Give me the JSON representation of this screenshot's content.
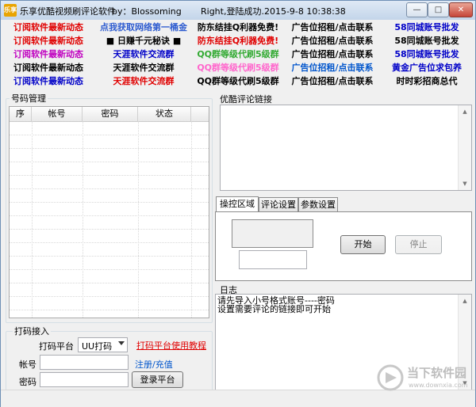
{
  "window": {
    "title": "乐享优酷视频刷评论软件",
    "by": "by：Blossoming",
    "status": "Right,登陆成功.2015-9-8 10:38:38",
    "app_icon_text": "乐享",
    "min_glyph": "—",
    "max_glyph": "□",
    "close_glyph": "✕"
  },
  "links": {
    "rows": [
      [
        {
          "text": "订阅软件最新动态",
          "color": "#e00000"
        },
        {
          "text": "点我获取网络第一桶金",
          "color": "#2f5dd0"
        },
        {
          "text": "防东结挂Q利器免费!",
          "color": "#000000"
        },
        {
          "text": "广告位招租/点击联系",
          "color": "#000000"
        },
        {
          "text": "58同城账号批发",
          "color": "#0000c8"
        }
      ],
      [
        {
          "text": "订阅软件最新动态",
          "color": "#e00000"
        },
        {
          "text": "■ 日赚千元秘诀 ■",
          "color": "#000000"
        },
        {
          "text": "防东结挂Q利器免费!",
          "color": "#e00000"
        },
        {
          "text": "广告位招租/点击联系",
          "color": "#000000"
        },
        {
          "text": "58同城账号批发",
          "color": "#000000"
        }
      ],
      [
        {
          "text": "订阅软件最新动态",
          "color": "#c000c0"
        },
        {
          "text": "天涯软件交流群",
          "color": "#0000c8"
        },
        {
          "text": "QQ群等级代刷5级群",
          "color": "#33aa33"
        },
        {
          "text": "广告位招租/点击联系",
          "color": "#000000"
        },
        {
          "text": "58同城账号批发",
          "color": "#0000c8"
        }
      ],
      [
        {
          "text": "订阅软件最新动态",
          "color": "#000000"
        },
        {
          "text": "天涯软件交流群",
          "color": "#000000"
        },
        {
          "text": "QQ群等级代刷5级群",
          "color": "#ff66cc"
        },
        {
          "text": "广告位招租/点击联系",
          "color": "#0055cc"
        },
        {
          "text": "黄金广告位求包养",
          "color": "#0000c8"
        }
      ],
      [
        {
          "text": "订阅软件最新动态",
          "color": "#0000c8"
        },
        {
          "text": "天涯软件交流群",
          "color": "#e00000"
        },
        {
          "text": "QQ群等级代刷5级群",
          "color": "#000000"
        },
        {
          "text": "广告位招租/点击联系",
          "color": "#000000"
        },
        {
          "text": "时时彩招商总代",
          "color": "#000000"
        }
      ]
    ]
  },
  "accounts": {
    "group_title": "号码管理",
    "columns": [
      "序",
      "帐号",
      "密码",
      "状态"
    ]
  },
  "links_panel": {
    "title": "优酷评论链接"
  },
  "tabs": {
    "items": [
      "操控区域",
      "评论设置",
      "参数设置"
    ],
    "active": 0
  },
  "control": {
    "start_label": "开始",
    "stop_label": "停止"
  },
  "log": {
    "title": "日志",
    "line1": "请先导入小号格式账号----密码",
    "line2": "设置需要评论的链接即可开始"
  },
  "captcha": {
    "group_title": "打码接入",
    "platform_label": "打码平台",
    "platform_value": "UU打码",
    "tutorial_link": "打码平台使用教程",
    "account_label": "帐号",
    "register_link": "注册/充值",
    "password_label": "密码",
    "login_button": "登录平台"
  },
  "watermark": {
    "text_cn": "当下软件园",
    "text_en": "www.downxia.com"
  }
}
